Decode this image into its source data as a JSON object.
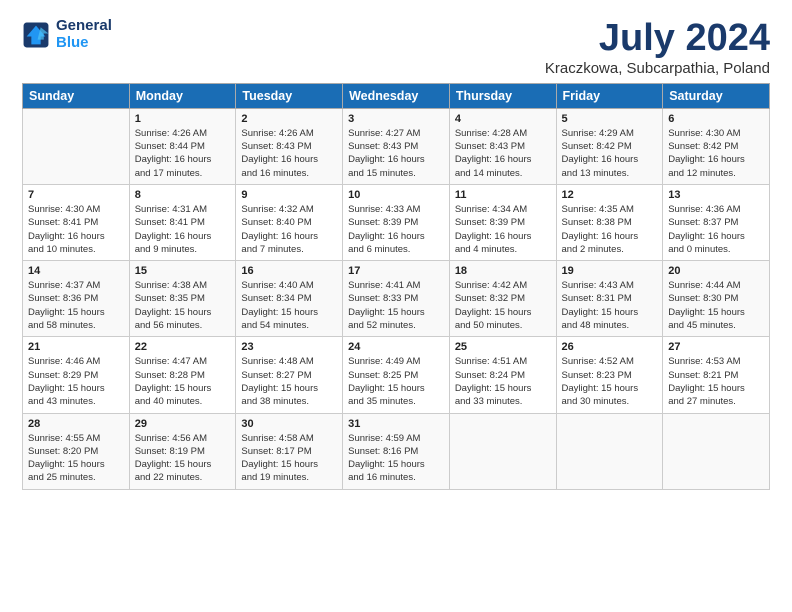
{
  "header": {
    "logo_line1": "General",
    "logo_line2": "Blue",
    "title": "July 2024",
    "subtitle": "Kraczkowa, Subcarpathia, Poland"
  },
  "columns": [
    "Sunday",
    "Monday",
    "Tuesday",
    "Wednesday",
    "Thursday",
    "Friday",
    "Saturday"
  ],
  "weeks": [
    [
      {
        "day": "",
        "info": ""
      },
      {
        "day": "1",
        "info": "Sunrise: 4:26 AM\nSunset: 8:44 PM\nDaylight: 16 hours\nand 17 minutes."
      },
      {
        "day": "2",
        "info": "Sunrise: 4:26 AM\nSunset: 8:43 PM\nDaylight: 16 hours\nand 16 minutes."
      },
      {
        "day": "3",
        "info": "Sunrise: 4:27 AM\nSunset: 8:43 PM\nDaylight: 16 hours\nand 15 minutes."
      },
      {
        "day": "4",
        "info": "Sunrise: 4:28 AM\nSunset: 8:43 PM\nDaylight: 16 hours\nand 14 minutes."
      },
      {
        "day": "5",
        "info": "Sunrise: 4:29 AM\nSunset: 8:42 PM\nDaylight: 16 hours\nand 13 minutes."
      },
      {
        "day": "6",
        "info": "Sunrise: 4:30 AM\nSunset: 8:42 PM\nDaylight: 16 hours\nand 12 minutes."
      }
    ],
    [
      {
        "day": "7",
        "info": "Sunrise: 4:30 AM\nSunset: 8:41 PM\nDaylight: 16 hours\nand 10 minutes."
      },
      {
        "day": "8",
        "info": "Sunrise: 4:31 AM\nSunset: 8:41 PM\nDaylight: 16 hours\nand 9 minutes."
      },
      {
        "day": "9",
        "info": "Sunrise: 4:32 AM\nSunset: 8:40 PM\nDaylight: 16 hours\nand 7 minutes."
      },
      {
        "day": "10",
        "info": "Sunrise: 4:33 AM\nSunset: 8:39 PM\nDaylight: 16 hours\nand 6 minutes."
      },
      {
        "day": "11",
        "info": "Sunrise: 4:34 AM\nSunset: 8:39 PM\nDaylight: 16 hours\nand 4 minutes."
      },
      {
        "day": "12",
        "info": "Sunrise: 4:35 AM\nSunset: 8:38 PM\nDaylight: 16 hours\nand 2 minutes."
      },
      {
        "day": "13",
        "info": "Sunrise: 4:36 AM\nSunset: 8:37 PM\nDaylight: 16 hours\nand 0 minutes."
      }
    ],
    [
      {
        "day": "14",
        "info": "Sunrise: 4:37 AM\nSunset: 8:36 PM\nDaylight: 15 hours\nand 58 minutes."
      },
      {
        "day": "15",
        "info": "Sunrise: 4:38 AM\nSunset: 8:35 PM\nDaylight: 15 hours\nand 56 minutes."
      },
      {
        "day": "16",
        "info": "Sunrise: 4:40 AM\nSunset: 8:34 PM\nDaylight: 15 hours\nand 54 minutes."
      },
      {
        "day": "17",
        "info": "Sunrise: 4:41 AM\nSunset: 8:33 PM\nDaylight: 15 hours\nand 52 minutes."
      },
      {
        "day": "18",
        "info": "Sunrise: 4:42 AM\nSunset: 8:32 PM\nDaylight: 15 hours\nand 50 minutes."
      },
      {
        "day": "19",
        "info": "Sunrise: 4:43 AM\nSunset: 8:31 PM\nDaylight: 15 hours\nand 48 minutes."
      },
      {
        "day": "20",
        "info": "Sunrise: 4:44 AM\nSunset: 8:30 PM\nDaylight: 15 hours\nand 45 minutes."
      }
    ],
    [
      {
        "day": "21",
        "info": "Sunrise: 4:46 AM\nSunset: 8:29 PM\nDaylight: 15 hours\nand 43 minutes."
      },
      {
        "day": "22",
        "info": "Sunrise: 4:47 AM\nSunset: 8:28 PM\nDaylight: 15 hours\nand 40 minutes."
      },
      {
        "day": "23",
        "info": "Sunrise: 4:48 AM\nSunset: 8:27 PM\nDaylight: 15 hours\nand 38 minutes."
      },
      {
        "day": "24",
        "info": "Sunrise: 4:49 AM\nSunset: 8:25 PM\nDaylight: 15 hours\nand 35 minutes."
      },
      {
        "day": "25",
        "info": "Sunrise: 4:51 AM\nSunset: 8:24 PM\nDaylight: 15 hours\nand 33 minutes."
      },
      {
        "day": "26",
        "info": "Sunrise: 4:52 AM\nSunset: 8:23 PM\nDaylight: 15 hours\nand 30 minutes."
      },
      {
        "day": "27",
        "info": "Sunrise: 4:53 AM\nSunset: 8:21 PM\nDaylight: 15 hours\nand 27 minutes."
      }
    ],
    [
      {
        "day": "28",
        "info": "Sunrise: 4:55 AM\nSunset: 8:20 PM\nDaylight: 15 hours\nand 25 minutes."
      },
      {
        "day": "29",
        "info": "Sunrise: 4:56 AM\nSunset: 8:19 PM\nDaylight: 15 hours\nand 22 minutes."
      },
      {
        "day": "30",
        "info": "Sunrise: 4:58 AM\nSunset: 8:17 PM\nDaylight: 15 hours\nand 19 minutes."
      },
      {
        "day": "31",
        "info": "Sunrise: 4:59 AM\nSunset: 8:16 PM\nDaylight: 15 hours\nand 16 minutes."
      },
      {
        "day": "",
        "info": ""
      },
      {
        "day": "",
        "info": ""
      },
      {
        "day": "",
        "info": ""
      }
    ]
  ]
}
